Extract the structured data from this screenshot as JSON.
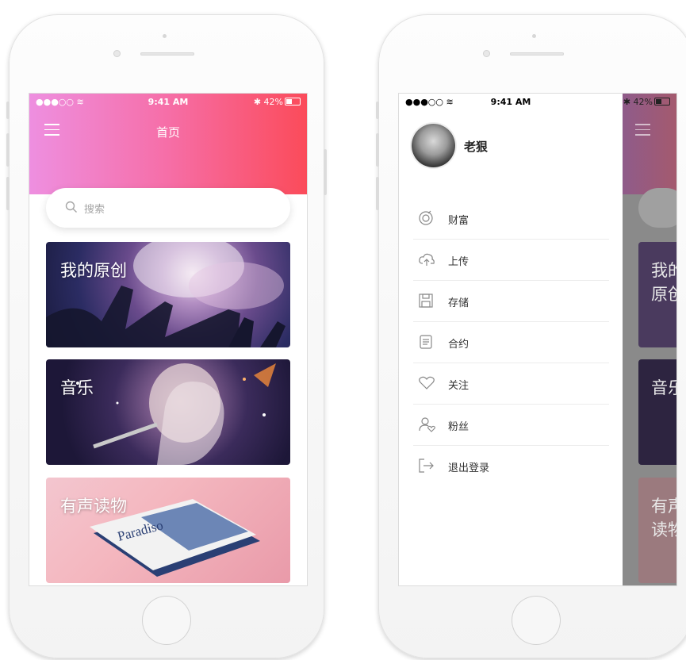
{
  "colors": {
    "gradient_start": "#ee8fe0",
    "gradient_end": "#fb4b5a",
    "overlay": "#8a8a8a"
  },
  "status_bar": {
    "signal": "●●●○○ ",
    "time": "9:41 AM",
    "battery": "42%"
  },
  "home": {
    "title": "首页",
    "search_placeholder": "搜索",
    "cards": [
      {
        "title": "我的原创"
      },
      {
        "title": "音乐"
      },
      {
        "title": "有声读物"
      }
    ]
  },
  "drawer": {
    "username": "老狠",
    "menu": [
      {
        "label": "财富",
        "icon": "wealth-icon"
      },
      {
        "label": "上传",
        "icon": "upload-cloud-icon"
      },
      {
        "label": "存储",
        "icon": "save-icon"
      },
      {
        "label": "合约",
        "icon": "contract-icon"
      },
      {
        "label": "关注",
        "icon": "heart-icon"
      },
      {
        "label": "粉丝",
        "icon": "fans-icon"
      },
      {
        "label": "退出登录",
        "icon": "logout-icon"
      }
    ]
  }
}
